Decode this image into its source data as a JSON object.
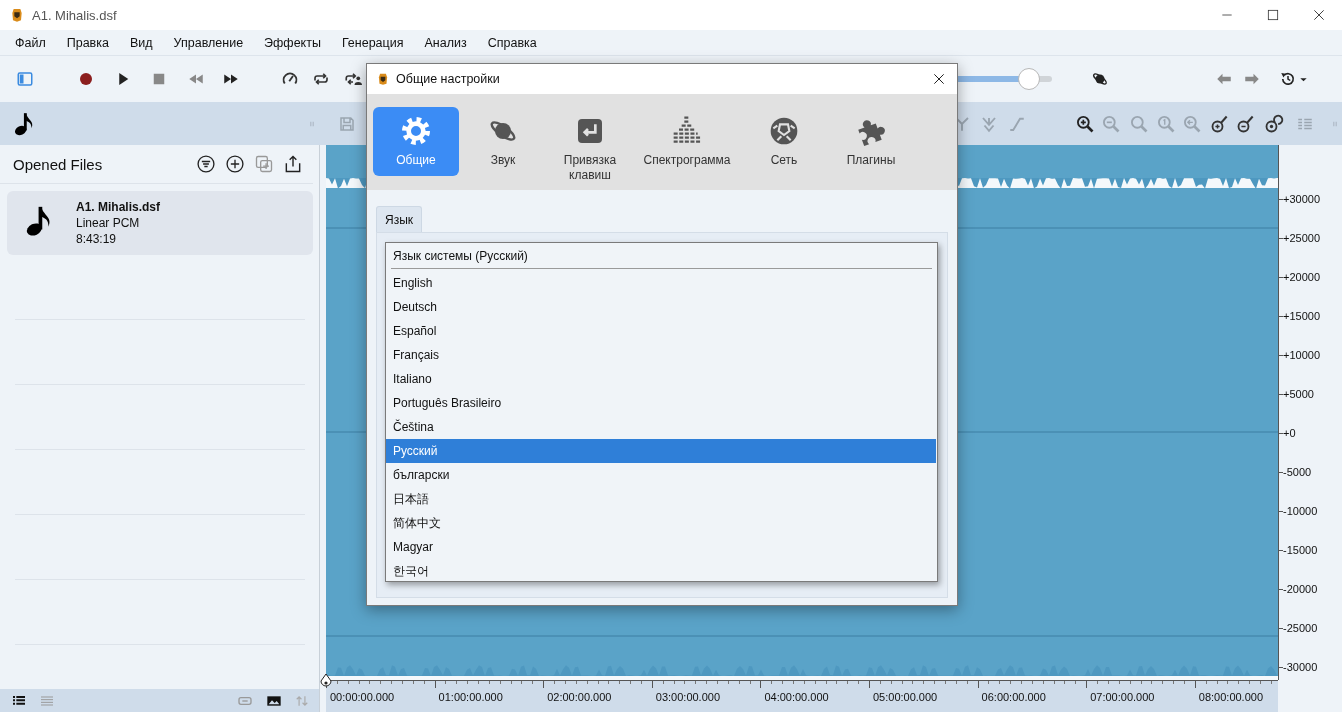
{
  "window": {
    "title": "A1. Mihalis.dsf"
  },
  "menu": [
    {
      "label": "Файл"
    },
    {
      "label": "Правка"
    },
    {
      "label": "Вид"
    },
    {
      "label": "Управление"
    },
    {
      "label": "Эффекты"
    },
    {
      "label": "Генерация"
    },
    {
      "label": "Анализ"
    },
    {
      "label": "Справка"
    }
  ],
  "toolbar": {
    "slider": {
      "level": 0.88
    }
  },
  "sidebar": {
    "title": "Opened Files",
    "files": [
      {
        "name": "A1. Mihalis.dsf",
        "format": "Linear PCM",
        "duration": "8:43:19",
        "selected": true
      }
    ]
  },
  "waveform": {
    "amplitude_labels": [
      "+30000",
      "+25000",
      "+20000",
      "+15000",
      "+10000",
      "+5000",
      "+0",
      "-5000",
      "-10000",
      "-15000",
      "-20000",
      "-25000",
      "-30000"
    ],
    "time_labels": [
      "00:00:00.000",
      "01:00:00.000",
      "02:00:00.000",
      "03:00:00.000",
      "04:00:00.000",
      "05:00:00.000",
      "06:00:00.000",
      "07:00:00.000",
      "08:00:00.000"
    ]
  },
  "dialog": {
    "title": "Общие настройки",
    "tabs": [
      {
        "label": "Общие",
        "kind": "gear",
        "selected": true
      },
      {
        "label": "Звук",
        "kind": "planet",
        "selected": false
      },
      {
        "label": "Привязка клавиш",
        "kind": "key",
        "selected": false
      },
      {
        "label": "Спектрограмма",
        "kind": "bars",
        "selected": false
      },
      {
        "label": "Сеть",
        "kind": "ball",
        "selected": false
      },
      {
        "label": "Плагины",
        "kind": "puzzle",
        "selected": false
      }
    ],
    "section_tab": {
      "label": "Язык"
    },
    "language_dropdown": {
      "system_option": "Язык системы (Русский)",
      "options": [
        {
          "label": "English",
          "selected": false
        },
        {
          "label": "Deutsch",
          "selected": false
        },
        {
          "label": "Español",
          "selected": false
        },
        {
          "label": "Français",
          "selected": false
        },
        {
          "label": "Italiano",
          "selected": false
        },
        {
          "label": "Português Brasileiro",
          "selected": false
        },
        {
          "label": "Čeština",
          "selected": false
        },
        {
          "label": "Русский",
          "selected": true
        },
        {
          "label": "български",
          "selected": false
        },
        {
          "label": "日本語",
          "selected": false
        },
        {
          "label": "简体中文",
          "selected": false
        },
        {
          "label": "Magyar",
          "selected": false
        },
        {
          "label": "한국어",
          "selected": false
        }
      ]
    }
  }
}
